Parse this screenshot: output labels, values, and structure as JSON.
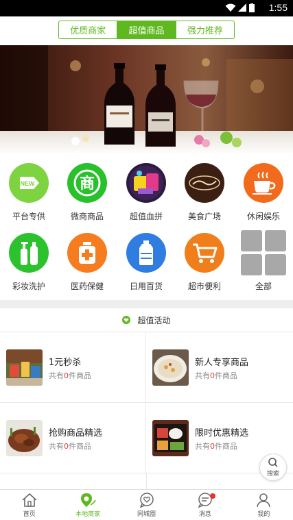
{
  "status": {
    "time": "1:55"
  },
  "tabs": [
    {
      "label": "优质商家",
      "active": false
    },
    {
      "label": "超值商品",
      "active": true
    },
    {
      "label": "强力推荐",
      "active": false
    }
  ],
  "categories": [
    {
      "label": "平台专供",
      "icon": "new-tag-icon",
      "color": "#7dd340"
    },
    {
      "label": "微商商品",
      "icon": "shop-icon",
      "color": "#29c12b"
    },
    {
      "label": "超值血拼",
      "icon": "super-value-icon",
      "color": "#4a2c6b"
    },
    {
      "label": "美食广场",
      "icon": "food-logo-icon",
      "color": "#3a1f12"
    },
    {
      "label": "休闲娱乐",
      "icon": "coffee-cup-icon",
      "color": "#f26a1b"
    },
    {
      "label": "彩妆洗护",
      "icon": "cosmetics-icon",
      "color": "#2cc22d"
    },
    {
      "label": "医药保健",
      "icon": "medicine-icon",
      "color": "#f57c1f"
    },
    {
      "label": "日用百货",
      "icon": "water-bottle-icon",
      "color": "#2f7de1"
    },
    {
      "label": "超市便利",
      "icon": "shopping-cart-icon",
      "color": "#f07e1a"
    },
    {
      "label": "全部",
      "icon": "grid-icon",
      "color": "#a8a8a8"
    }
  ],
  "section": {
    "title": "超值活动",
    "accent": "#5fb820"
  },
  "cards": [
    {
      "title": "1元秒杀",
      "prefix": "共有",
      "count": "0",
      "suffix": "件商品"
    },
    {
      "title": "新人专享商品",
      "prefix": "共有",
      "count": "0",
      "suffix": "件商品"
    },
    {
      "title": "抢购商品精选",
      "prefix": "共有",
      "count": "0",
      "suffix": "件商品"
    },
    {
      "title": "限时优惠精选",
      "prefix": "共有",
      "count": "0",
      "suffix": "件商品"
    }
  ],
  "search_fab": {
    "label": "搜索"
  },
  "nav": [
    {
      "label": "首页",
      "icon": "home-icon",
      "active": false
    },
    {
      "label": "本地商家",
      "icon": "location-pin-icon",
      "active": true
    },
    {
      "label": "同城圈",
      "icon": "heart-bubble-icon",
      "active": false
    },
    {
      "label": "消息",
      "icon": "message-icon",
      "active": false,
      "badge": true
    },
    {
      "label": "我的",
      "icon": "person-icon",
      "active": false
    }
  ]
}
